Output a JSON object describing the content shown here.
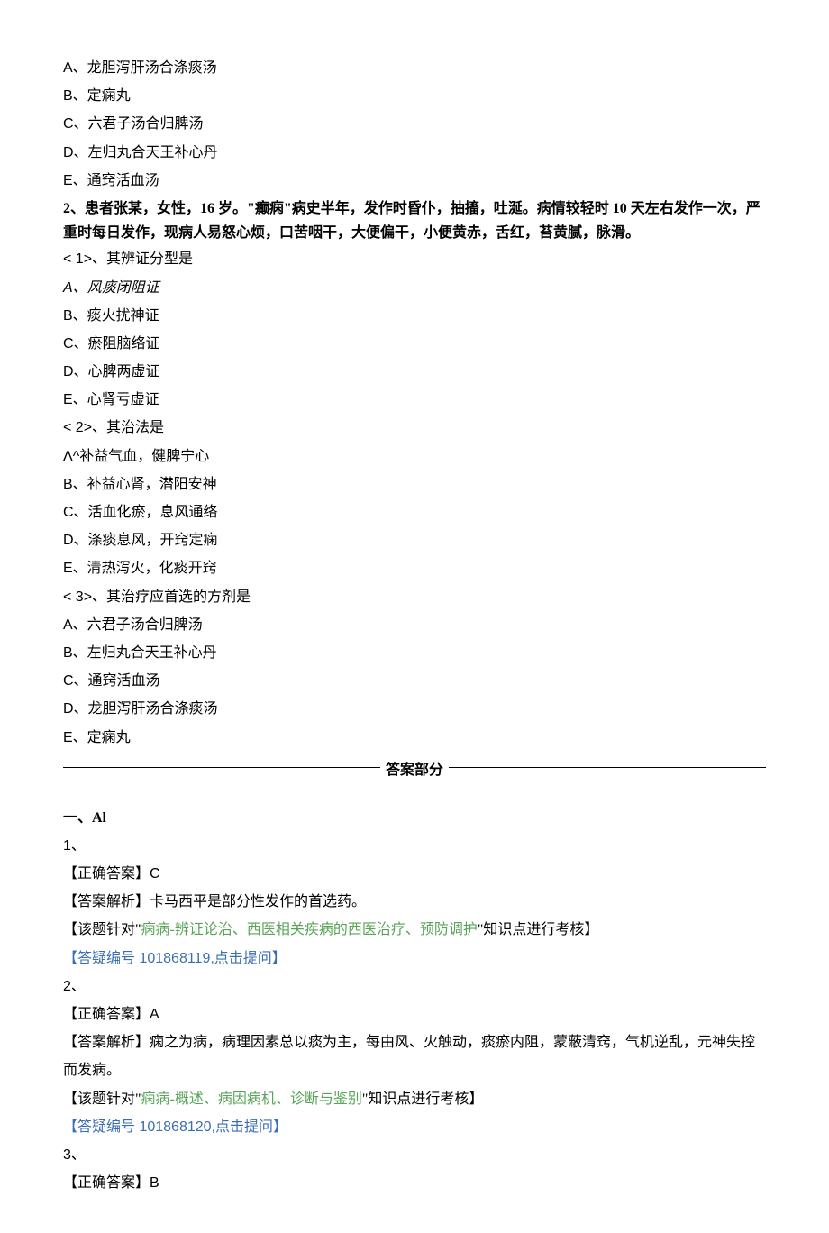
{
  "q1": {
    "A": "A、龙胆泻肝汤合涤痰汤",
    "B": "B、定痫丸",
    "C": "C、六君子汤合归脾汤",
    "D": "D、左归丸合天王补心丹",
    "E": "E、通窍活血汤"
  },
  "q2": {
    "stem": "2、患者张某，女性，16 岁。\"癫痫\"病史半年，发作时昏仆，抽搐，吐涎。病情较轻时 10 天左右发作一次，严重时每日发作，现病人易怒心烦，口苦咽干，大便偏干，小便黄赤，舌红，苔黄腻，脉滑。",
    "s1": {
      "lead": "<  1>、其辨证分型是",
      "A": "A、风痰闭阻证",
      "B": "B、痰火扰神证",
      "C": "C、瘀阻脑络证",
      "D": "D、心脾两虚证",
      "E": "E、心肾亏虚证"
    },
    "s2": {
      "lead": "<  2>、其治法是",
      "A": "Λ^补益气血，健脾宁心",
      "B": "B、补益心肾，潜阳安神",
      "C": "C、活血化瘀，息风通络",
      "D": "D、涤痰息风，开窍定痫",
      "E": "E、清热泻火，化痰开窍"
    },
    "s3": {
      "lead": "<  3>、其治疗应首选的方剂是",
      "A": "A、六君子汤合归脾汤",
      "B": "B、左归丸合天王补心丹",
      "C": "C、通窍活血汤",
      "D": "D、龙胆泻肝汤合涤痰汤",
      "E": "E、定痫丸"
    }
  },
  "answers": {
    "section_title": "答案部分",
    "group_title": "一、Al",
    "a1": {
      "num": "1、",
      "correct": "【正确答案】C",
      "explain": "【答案解析】卡马西平是部分性发作的首选药。",
      "topic_prefix": "【该题针对\"",
      "topic_green": "痫病-辨证论治、西医相关疾病的西医治疗、预防调护",
      "topic_suffix": "\"知识点进行考核】",
      "link": "【答疑编号 101868119,点击提问】"
    },
    "a2": {
      "num": "2、",
      "correct": "【正确答案】A",
      "explain": "【答案解析】痫之为病，病理因素总以痰为主，每由风、火触动，痰瘀内阻，蒙蔽清窍，气机逆乱，元神失控而发病。",
      "topic_prefix": "【该题针对\"",
      "topic_green": "痫病-概述、病因病机、诊断与鉴别",
      "topic_suffix": "\"知识点进行考核】",
      "link": "【答疑编号 101868120,点击提问】"
    },
    "a3": {
      "num": "3、",
      "correct": "【正确答案】B"
    }
  }
}
